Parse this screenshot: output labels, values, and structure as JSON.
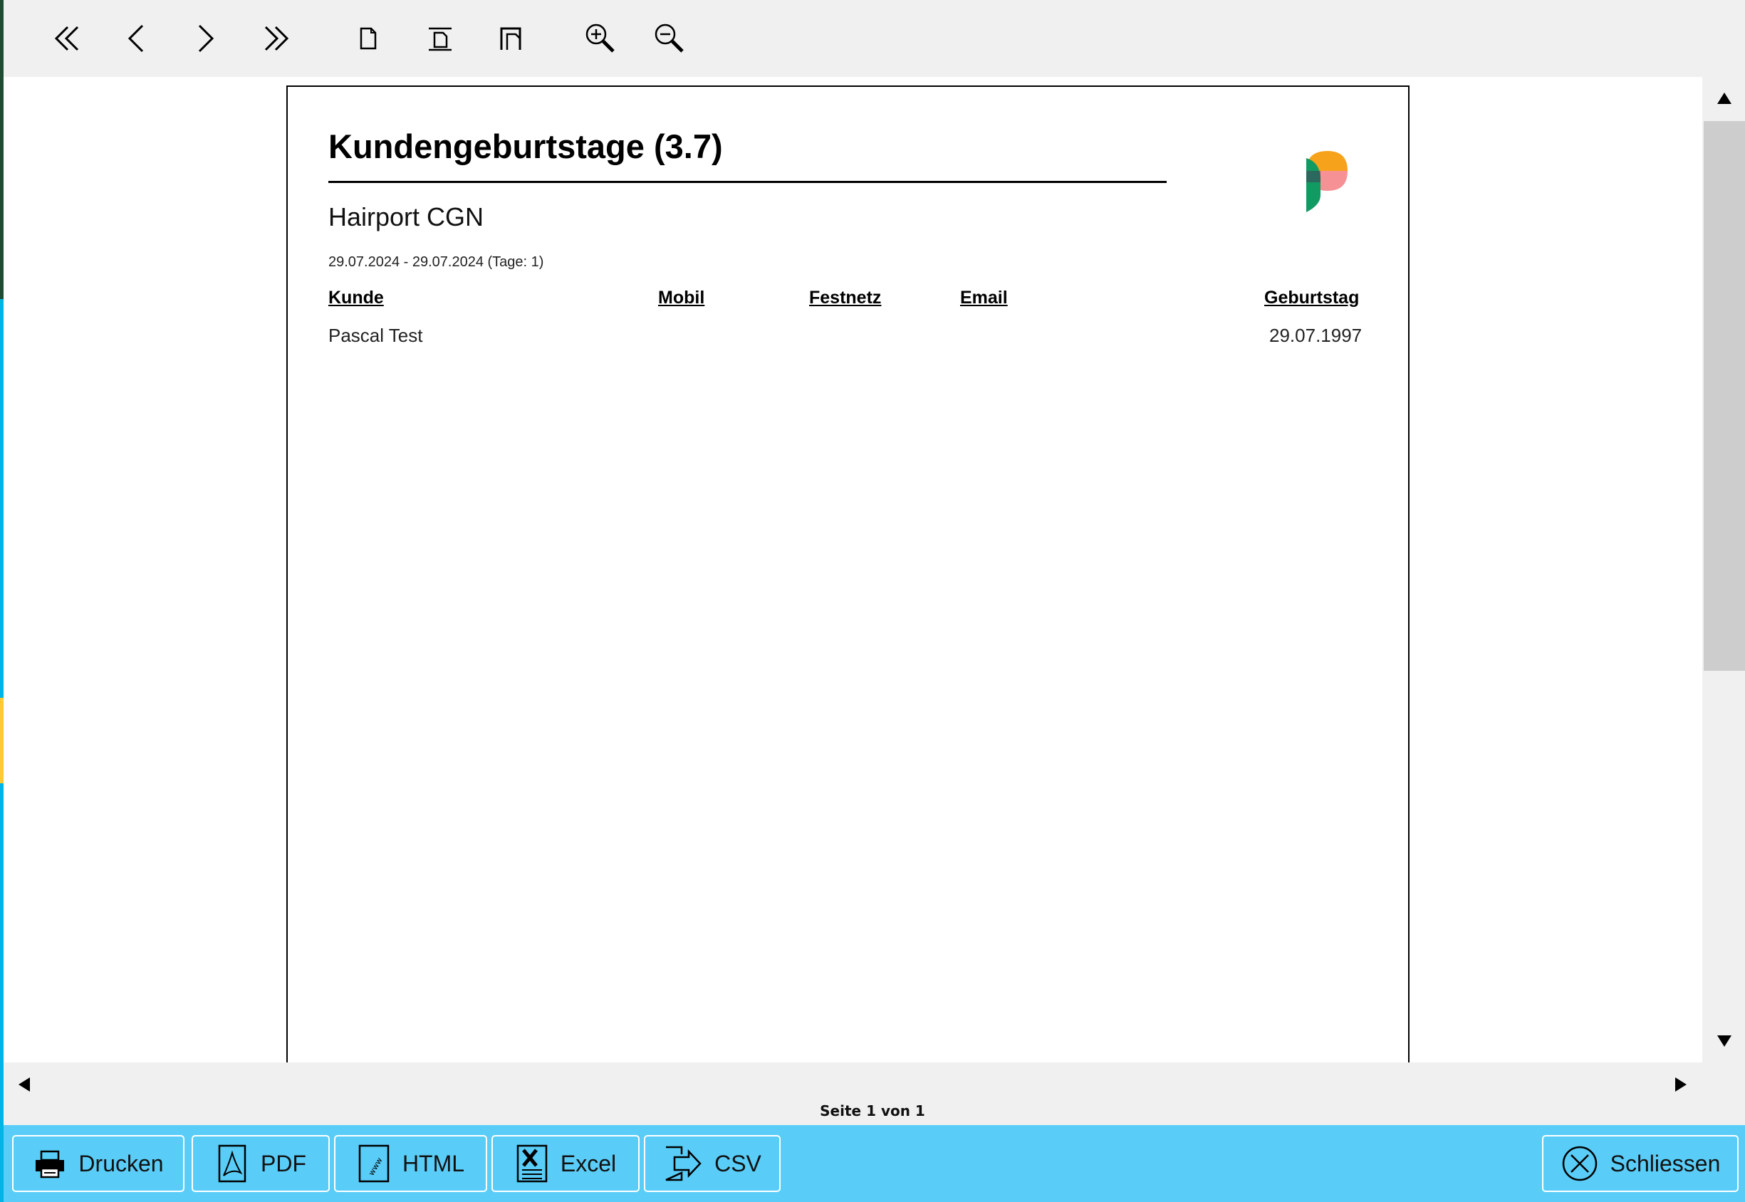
{
  "toolbar": {
    "buttons": [
      {
        "name": "first-page-button",
        "icon": "double-chevron-left-icon"
      },
      {
        "name": "prev-page-button",
        "icon": "chevron-left-icon"
      },
      {
        "name": "next-page-button",
        "icon": "chevron-right-icon"
      },
      {
        "name": "last-page-button",
        "icon": "double-chevron-right-icon"
      },
      {
        "name": "full-page-button",
        "icon": "page-icon"
      },
      {
        "name": "page-width-button",
        "icon": "page-width-icon"
      },
      {
        "name": "two-pages-button",
        "icon": "multi-page-icon"
      },
      {
        "name": "zoom-in-button",
        "icon": "zoom-in-icon"
      },
      {
        "name": "zoom-out-button",
        "icon": "zoom-out-icon"
      }
    ]
  },
  "report": {
    "title": "Kundengeburtstage (3.7)",
    "subtitle": "Hairport CGN",
    "date_range": "29.07.2024 - 29.07.2024 (Tage: 1)",
    "columns": {
      "kunde": "Kunde",
      "mobil": "Mobil",
      "festnetz": "Festnetz",
      "email": "Email",
      "geburtstag": "Geburtstag"
    },
    "rows": [
      {
        "kunde": "Pascal Test",
        "mobil": "",
        "festnetz": "",
        "email": "",
        "geburtstag": "29.07.1997"
      }
    ]
  },
  "status": {
    "page_info": "Seite 1 von 1"
  },
  "bottom": {
    "print": "Drucken",
    "pdf": "PDF",
    "html": "HTML",
    "excel": "Excel",
    "csv": "CSV",
    "close": "Schliessen"
  },
  "colors": {
    "accent": "#59cdf8",
    "side_strip": "#00b4e6",
    "logo_orange": "#f7a21b",
    "logo_green": "#129a63",
    "logo_pink": "#f5858b"
  }
}
